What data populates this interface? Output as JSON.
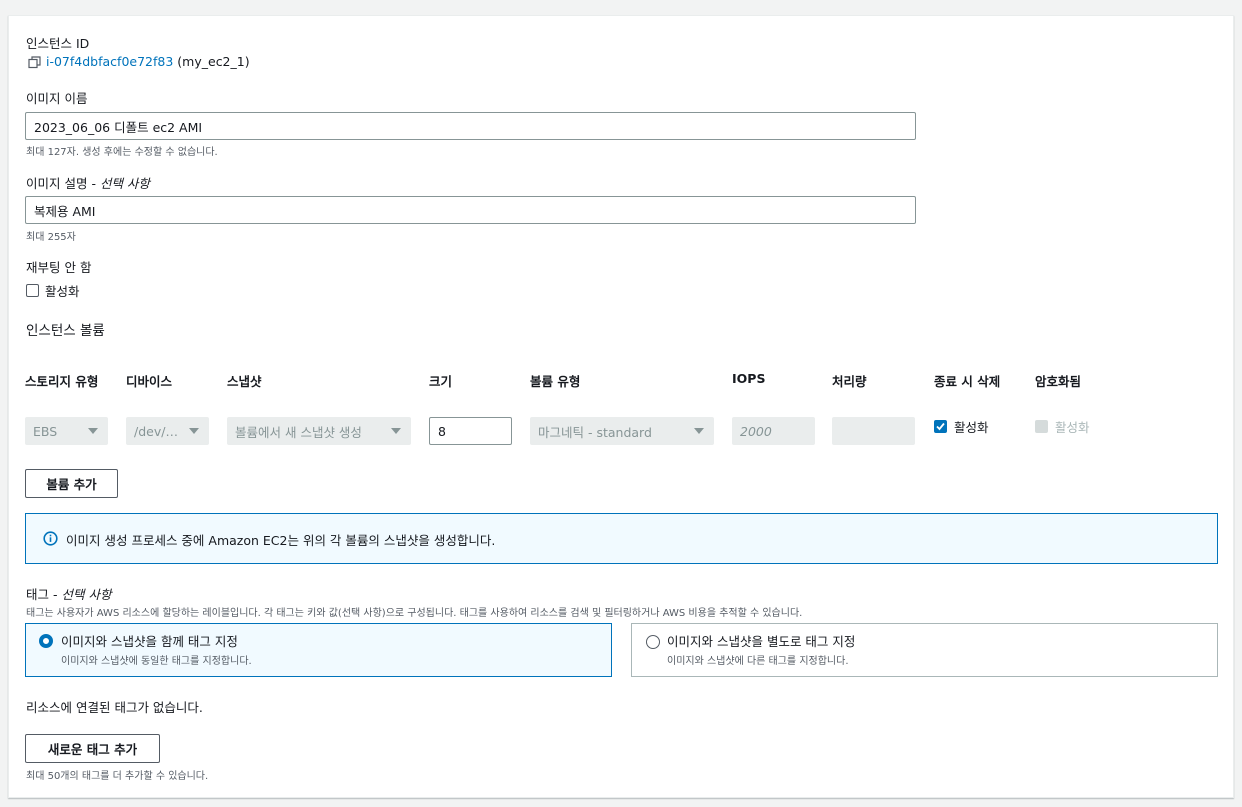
{
  "instance": {
    "id_label": "인스턴스 ID",
    "id_value": "i-07f4dbfacf0e72f83",
    "id_name": "(my_ec2_1)"
  },
  "image_name": {
    "label": "이미지 이름",
    "value": "2023_06_06 디폴트 ec2 AMI",
    "hint": "최대 127자. 생성 후에는 수정할 수 없습니다."
  },
  "image_desc": {
    "label": "이미지 설명 - ",
    "label_optional": "선택 사항",
    "value": "복제용 AMI",
    "hint": "최대 255자"
  },
  "no_reboot": {
    "label": "재부팅 안 함",
    "checkbox_label": "활성화"
  },
  "volumes": {
    "section_title": "인스턴스 볼륨",
    "headers": [
      "스토리지 유형",
      "디바이스",
      "스냅샷",
      "크기",
      "볼륨 유형",
      "IOPS",
      "처리량",
      "종료 시 삭제",
      "암호화됨"
    ],
    "row": {
      "storage_type": "EBS",
      "device": "/dev/…",
      "snapshot": "볼륨에서 새 스냅샷 생성",
      "size": "8",
      "volume_type": "마그네틱 - standard",
      "iops": "2000",
      "throughput": "",
      "delete_on_term": "활성화",
      "encrypted": "활성화"
    },
    "add_button": "볼륨 추가"
  },
  "info": {
    "text": "이미지 생성 프로세스 중에 Amazon EC2는 위의 각 볼륨의 스냅샷을 생성합니다."
  },
  "tags": {
    "label": "태그 - ",
    "label_optional": "선택 사항",
    "desc": "태그는 사용자가 AWS 리소스에 할당하는 레이블입니다. 각 태그는 키와 값(선택 사항)으로 구성됩니다. 태그를 사용하여 리소스를 검색 및 필터링하거나 AWS 비용을 추적할 수 있습니다.",
    "option1_title": "이미지와 스냅샷을 함께 태그 지정",
    "option1_desc": "이미지와 스냅샷에 동일한 태그를 지정합니다.",
    "option2_title": "이미지와 스냅샷을 별도로 태그 지정",
    "option2_desc": "이미지와 스냅샷에 다른 태그를 지정합니다.",
    "empty_text": "리소스에 연결된 태그가 없습니다.",
    "add_button": "새로운 태그 추가",
    "add_hint": "최대 50개의 태그를 더 추가할 수 있습니다."
  },
  "colors": {
    "accent": "#0073bb",
    "info_bg": "#f1faff"
  }
}
